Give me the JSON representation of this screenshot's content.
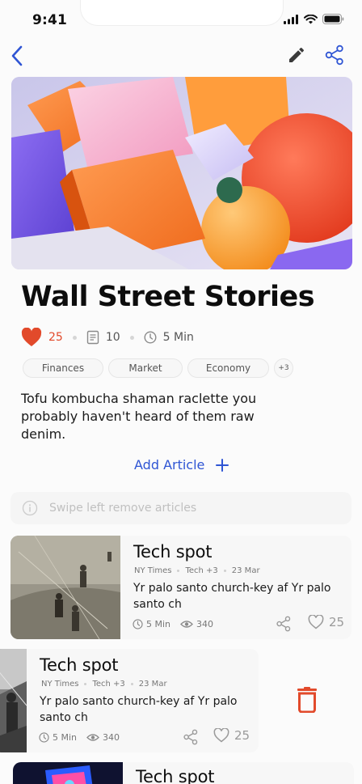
{
  "status_bar": {
    "time": "9:41"
  },
  "icons": {
    "back": "chevron-left-icon",
    "edit": "pencil-icon",
    "share": "share-icon",
    "heart": "heart-icon",
    "articles": "document-icon",
    "clock": "clock-icon",
    "add": "plus-icon",
    "info": "info-icon",
    "views": "eye-icon",
    "delete": "trash-icon"
  },
  "colors": {
    "accent": "#2f55d4",
    "like": "#e24a2b",
    "delete": "#e24a2b"
  },
  "collection": {
    "title": "Wall Street Stories",
    "likes": "25",
    "articles": "10",
    "read_time": "5 Min",
    "tags": [
      "Finances",
      "Market",
      "Economy"
    ],
    "tags_more": "+3",
    "description": "Tofu kombucha shaman raclette you probably haven't heard of them raw denim.",
    "add_article_label": "Add Article",
    "swipe_hint": "Swipe left remove articles"
  },
  "articles": [
    {
      "title": "Tech spot",
      "source": "NY Times",
      "category": "Tech +3",
      "date": "23 Mar",
      "excerpt": "Yr palo santo church-key af Yr palo santo ch",
      "read_time": "5 Min",
      "views": "340",
      "likes": "25"
    },
    {
      "title": "Tech spot",
      "source": "NY Times",
      "category": "Tech +3",
      "date": "23 Mar",
      "excerpt": "Yr palo santo church-key af Yr palo santo ch",
      "read_time": "5 Min",
      "views": "340",
      "likes": "25"
    },
    {
      "title": "Tech spot"
    }
  ]
}
